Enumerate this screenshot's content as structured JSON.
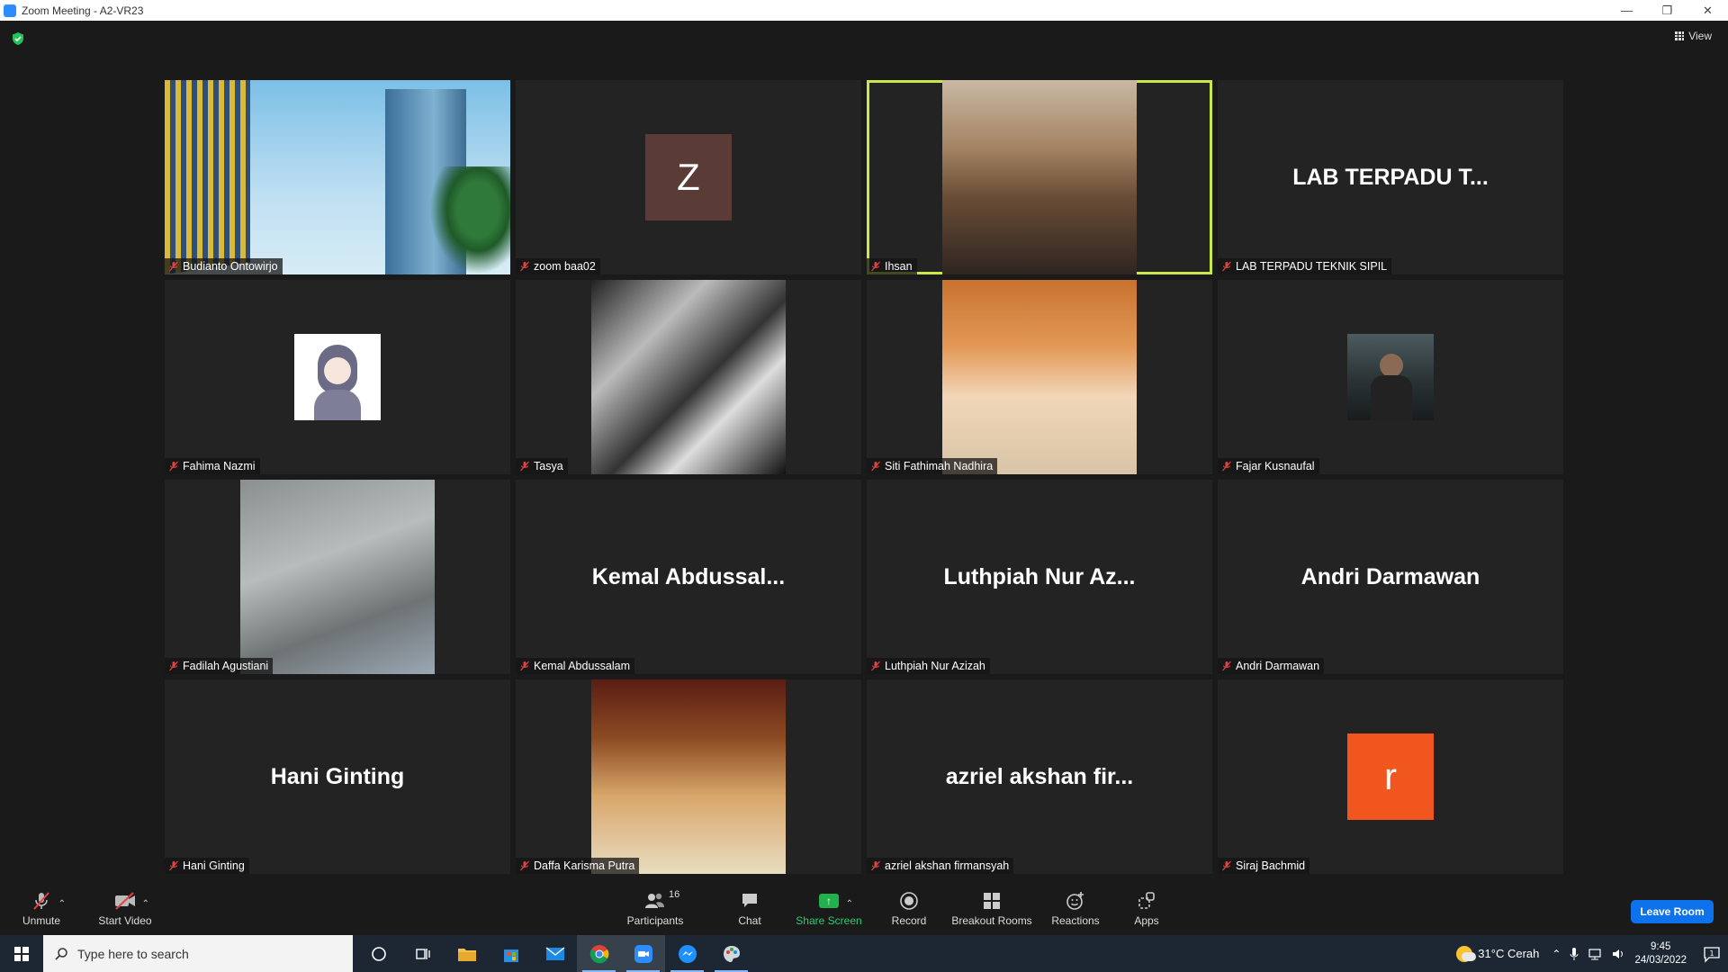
{
  "window": {
    "title": "Zoom Meeting - A2-VR23",
    "controls": [
      "—",
      "❐",
      "✕"
    ]
  },
  "header": {
    "view_label": "View"
  },
  "tiles": [
    {
      "name": "Budianto Ontowirjo",
      "kind": "video",
      "photo": "building"
    },
    {
      "name": "zoom baa02",
      "kind": "avatar",
      "avatar_letter": "Z",
      "avatar_color": "#5a3b36"
    },
    {
      "name": "Ihsan",
      "kind": "video",
      "photo": "lab",
      "active_speaker": true
    },
    {
      "name": "LAB TERPADU TEKNIK SIPIL",
      "kind": "name",
      "display": "LAB TERPADU T..."
    },
    {
      "name": "Fahima Nazmi",
      "kind": "small-photo",
      "photo": "hijab"
    },
    {
      "name": "Tasya",
      "kind": "video",
      "photo": "masks"
    },
    {
      "name": "Siti Fathimah Nadhira",
      "kind": "video",
      "photo": "anime"
    },
    {
      "name": "Fajar Kusnaufal",
      "kind": "small-photo",
      "photo": "fajar"
    },
    {
      "name": "Fadilah Agustiani",
      "kind": "video",
      "photo": "street"
    },
    {
      "name": "Kemal Abdussalam",
      "kind": "name",
      "display": "Kemal  Abdussal..."
    },
    {
      "name": "Luthpiah Nur Azizah",
      "kind": "name",
      "display": "Luthpiah Nur Az..."
    },
    {
      "name": "Andri Darmawan",
      "kind": "name",
      "display": "Andri Darmawan"
    },
    {
      "name": "Hani Ginting",
      "kind": "name",
      "display": "Hani Ginting"
    },
    {
      "name": "Daffa Karisma Putra",
      "kind": "video",
      "photo": "man"
    },
    {
      "name": "azriel akshan firmansyah",
      "kind": "name",
      "display": "azriel akshan fir..."
    },
    {
      "name": "Siraj Bachmid",
      "kind": "avatar",
      "avatar_letter": "r",
      "avatar_color": "#f0561d"
    }
  ],
  "toolbar": {
    "unmute": "Unmute",
    "start_video": "Start Video",
    "participants": "Participants",
    "participants_count": "16",
    "chat": "Chat",
    "share_screen": "Share Screen",
    "record": "Record",
    "breakout_rooms": "Breakout Rooms",
    "reactions": "Reactions",
    "apps": "Apps",
    "leave": "Leave Room"
  },
  "taskbar": {
    "search_placeholder": "Type here to search",
    "weather": "31°C  Cerah",
    "time": "9:45",
    "date": "24/03/2022",
    "notification_count": "1"
  },
  "colors": {
    "accent_active": "#c8e84a",
    "share_green": "#22b14c",
    "leave_blue": "#0e72ed",
    "mute_red": "#e04343"
  }
}
